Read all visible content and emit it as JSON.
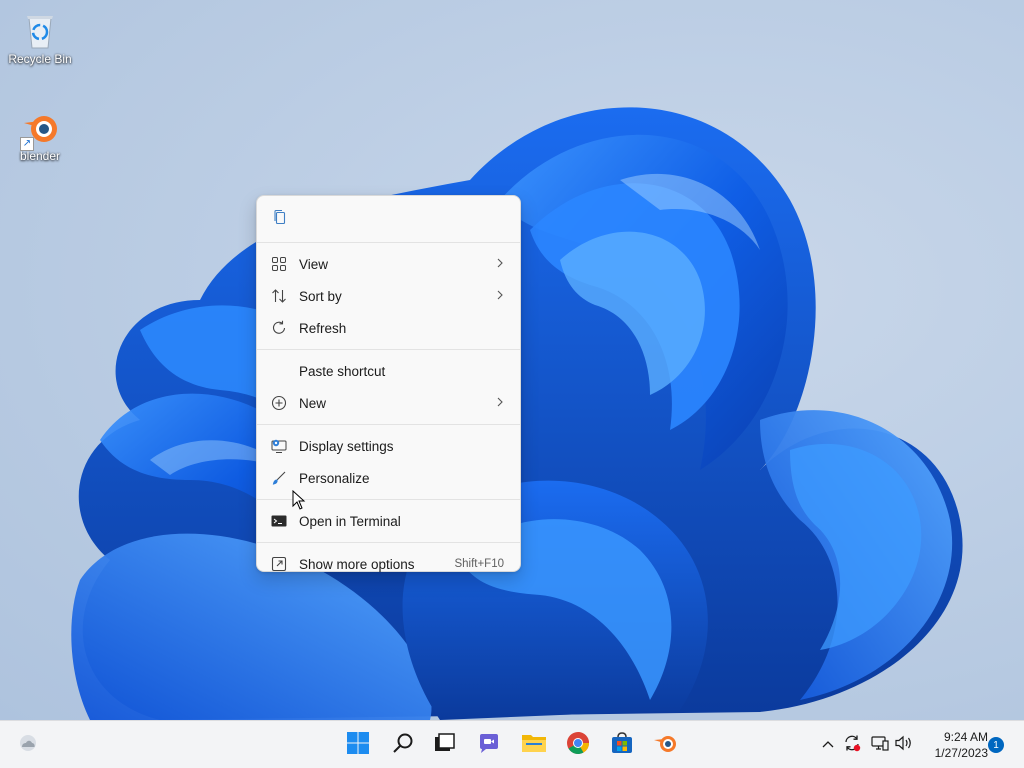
{
  "desktop": {
    "icons": [
      {
        "label": "Recycle Bin",
        "icon": "recycle-bin-icon"
      },
      {
        "label": "blender",
        "icon": "blender-icon"
      }
    ]
  },
  "context_menu": {
    "top_actions": [
      {
        "icon": "copy-icon"
      }
    ],
    "groups": [
      [
        {
          "label": "View",
          "icon": "grid-icon",
          "submenu": true
        },
        {
          "label": "Sort by",
          "icon": "sort-icon",
          "submenu": true
        },
        {
          "label": "Refresh",
          "icon": "refresh-icon",
          "submenu": false
        }
      ],
      [
        {
          "label": "Paste shortcut",
          "icon": "",
          "submenu": false
        },
        {
          "label": "New",
          "icon": "plus-circle-icon",
          "submenu": true
        }
      ],
      [
        {
          "label": "Display settings",
          "icon": "display-settings-icon",
          "submenu": false
        },
        {
          "label": "Personalize",
          "icon": "brush-icon",
          "submenu": false
        }
      ],
      [
        {
          "label": "Open in Terminal",
          "icon": "terminal-icon",
          "submenu": false
        }
      ],
      [
        {
          "label": "Show more options",
          "icon": "expand-icon",
          "submenu": false,
          "shortcut": "Shift+F10"
        }
      ]
    ]
  },
  "taskbar": {
    "apps": [
      "start-icon",
      "search-icon",
      "task-view-icon",
      "chat-icon",
      "file-explorer-icon",
      "chrome-icon",
      "store-icon",
      "blender-icon"
    ],
    "tray": [
      "chevron-up-icon",
      "sync-icon",
      "network-icon",
      "volume-icon"
    ],
    "time": "9:24 AM",
    "date": "1/27/2023",
    "notifications": "1"
  },
  "colors": {
    "accent": "#0067c0",
    "wallpaper_blue": "#1565e0",
    "taskbar_bg": "#f3f4f6"
  }
}
